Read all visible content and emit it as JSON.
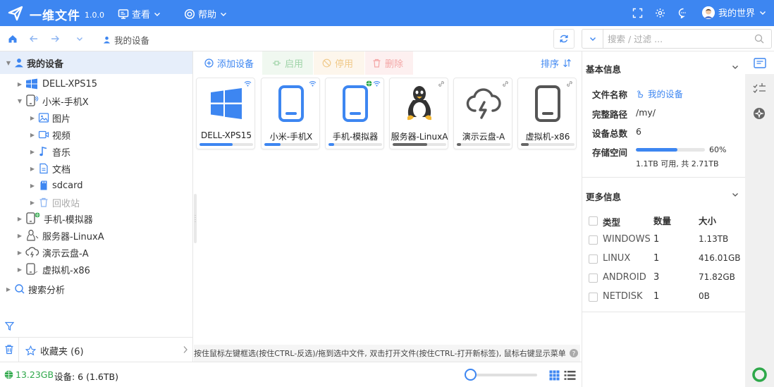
{
  "app": {
    "title": "一维文件",
    "version": "1.0.0"
  },
  "menu": {
    "view": "查看",
    "help": "帮助"
  },
  "user": {
    "name": "我的世界"
  },
  "breadcrumb": {
    "current": "我的设备"
  },
  "filter": {
    "placeholder": "搜索 / 过滤 ..."
  },
  "tree": {
    "root": "我的设备",
    "devices": [
      {
        "label": "DELL-XPS15",
        "icon": "windows-icon"
      },
      {
        "label": "小米-手机X",
        "icon": "phone-icon",
        "expanded": true
      },
      {
        "label": "手机-模拟器",
        "icon": "phone-icon"
      },
      {
        "label": "服务器-LinuxA",
        "icon": "linux-icon"
      },
      {
        "label": "演示云盘-A",
        "icon": "cloud-icon"
      },
      {
        "label": "虚拟机-x86",
        "icon": "phone-icon"
      }
    ],
    "children": [
      {
        "label": "图片",
        "icon": "image-icon"
      },
      {
        "label": "视频",
        "icon": "video-icon"
      },
      {
        "label": "音乐",
        "icon": "music-icon"
      },
      {
        "label": "文档",
        "icon": "document-icon"
      },
      {
        "label": "sdcard",
        "icon": "sdcard-icon"
      },
      {
        "label": "回收站",
        "icon": "trash-icon"
      }
    ],
    "search": "搜索分析",
    "favorites": "收藏夹 (6)"
  },
  "toolbar": {
    "add": "添加设备",
    "enable": "启用",
    "disable": "停用",
    "delete": "删除",
    "sort": "排序"
  },
  "cards": [
    {
      "label": "DELL-XPS15",
      "icon": "windows-icon",
      "usage": 0.62,
      "color": "#3d86f1"
    },
    {
      "label": "小米-手机X",
      "icon": "phone-icon",
      "usage": 0.3,
      "color": "#3d86f1"
    },
    {
      "label": "手机-模拟器",
      "icon": "phone-icon",
      "usage": 0.1,
      "color": "#3d86f1"
    },
    {
      "label": "服务器-LinuxA",
      "icon": "linux-icon",
      "usage": 0.65,
      "color": "#666666"
    },
    {
      "label": "演示云盘-A",
      "icon": "cloud-icon",
      "usage": 0.08,
      "color": "#666666"
    },
    {
      "label": "虚拟机-x86",
      "icon": "phone-icon",
      "usage": 0.15,
      "color": "#666666"
    }
  ],
  "hint": "按住鼠标左键框选(按住CTRL-反选)/拖到选中文件, 双击打开文件(按住CTRL-打开新标签), 鼠标右键显示菜单",
  "basic": {
    "title": "基本信息",
    "name_label": "文件名称",
    "name_value": "我的设备",
    "path_label": "完整路径",
    "path_value": "/my/",
    "count_label": "设备总数",
    "count_value": "6",
    "space_label": "存储空间",
    "space_percent": "60%",
    "space_fraction": 0.6,
    "space_detail": "1.1TB 可用, 共 2.71TB"
  },
  "more": {
    "title": "更多信息",
    "headers": {
      "type": "类型",
      "count": "数量",
      "size": "大小"
    },
    "rows": [
      {
        "type": "WINDOWS",
        "count": "1",
        "size": "1.13TB"
      },
      {
        "type": "LINUX",
        "count": "1",
        "size": "416.01GB"
      },
      {
        "type": "ANDROID",
        "count": "3",
        "size": "71.82GB"
      },
      {
        "type": "NETDISK",
        "count": "1",
        "size": "0B"
      }
    ]
  },
  "status": {
    "free": "13.23GB",
    "devices": "设备: 6 (1.6TB)",
    "zoom": 0.05
  },
  "colors": {
    "primary": "#3d86f1",
    "green": "#2ea84a"
  }
}
